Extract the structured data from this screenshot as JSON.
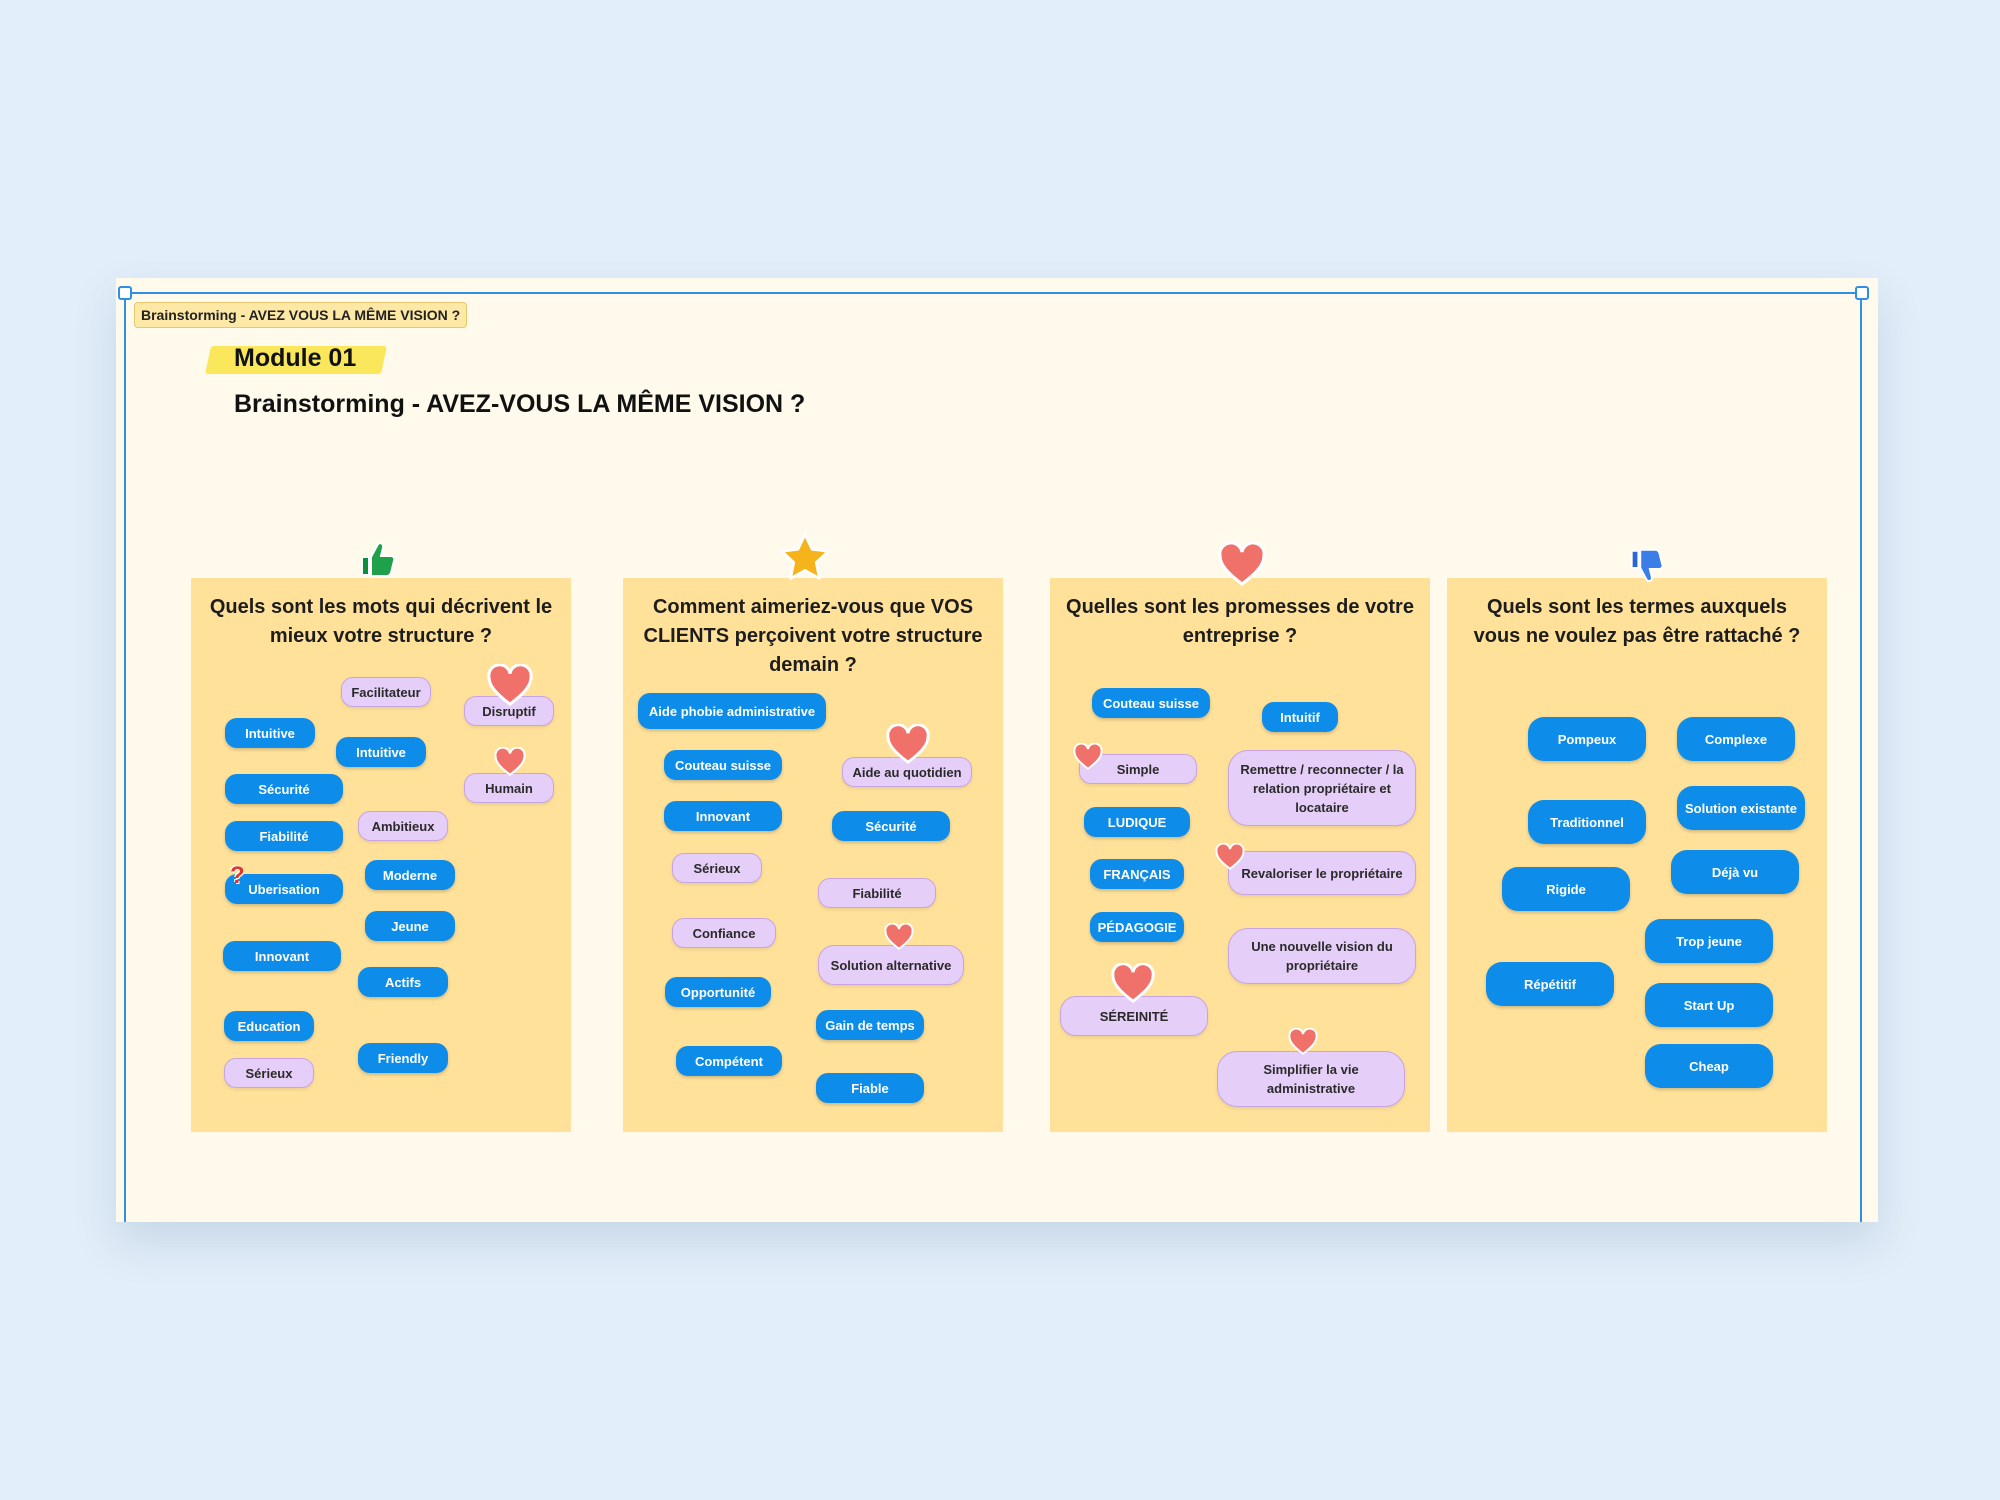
{
  "frame_label": "Brainstorming - AVEZ VOUS LA MÊME VISION ?",
  "module": "Module 01",
  "title": "Brainstorming - AVEZ-VOUS LA MÊME VISION ?",
  "columns": [
    {
      "icon": "thumbs-up-icon",
      "question": "Quels sont les mots qui décrivent le mieux votre structure ?",
      "chips": [
        "Facilitateur",
        "Disruptif",
        "Intuitive",
        "Intuitive",
        "Humain",
        "Sécurité",
        "Ambitieux",
        "Fiabilité",
        "Moderne",
        "Uberisation",
        "Jeune",
        "Innovant",
        "Actifs",
        "Education",
        "Friendly",
        "Sérieux"
      ]
    },
    {
      "icon": "star-icon",
      "question": "Comment aimeriez-vous que VOS CLIENTS perçoivent votre structure demain ?",
      "chips": [
        "Aide phobie administrative",
        "Couteau suisse",
        "Aide au quotidien",
        "Innovant",
        "Sécurité",
        "Sérieux",
        "Fiabilité",
        "Confiance",
        "Solution alternative",
        "Opportunité",
        "Gain de temps",
        "Compétent",
        "Fiable"
      ]
    },
    {
      "icon": "heart-icon",
      "question": "Quelles sont les promesses de votre entreprise ?",
      "chips": [
        "Couteau suisse",
        "Intuitif",
        "Simple",
        "Remettre / reconnecter / la relation propriétaire et locataire",
        "LUDIQUE",
        "FRANÇAIS",
        "Revaloriser le propriétaire",
        "PÉDAGOGIE",
        "Une nouvelle vision du propriétaire",
        "SÉREINITÉ",
        "Simplifier la vie administrative"
      ]
    },
    {
      "icon": "thumbs-down-icon",
      "question": "Quels sont les termes auxquels vous ne voulez pas être rattaché ?",
      "chips": [
        "Pompeux",
        "Complexe",
        "Traditionnel",
        "Solution existante",
        "Rigide",
        "Déjà vu",
        "Trop jeune",
        "Répétitif",
        "Start Up",
        "Cheap"
      ]
    }
  ],
  "colors": {
    "background": "#e2eef9",
    "board": "#fffaeb",
    "column": "#ffe19a",
    "chip_blue": "#0d8de9",
    "chip_purple": "#e5cef7",
    "selection": "#2f8fe6",
    "heart": "#f0706a"
  },
  "question_mark": "?"
}
